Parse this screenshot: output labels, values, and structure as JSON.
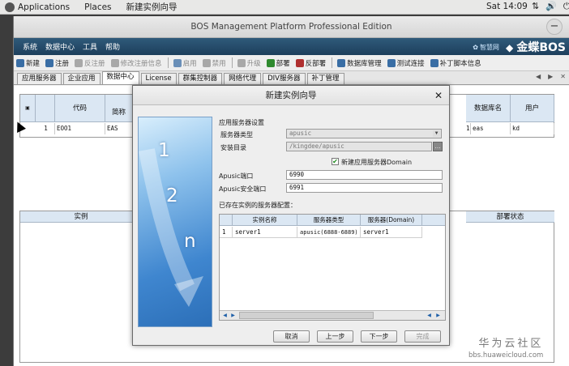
{
  "gnome": {
    "applications": "Applications",
    "places": "Places",
    "active_window": "新建实例向导",
    "clock": "Sat 14:09"
  },
  "window": {
    "title": "BOS Management Platform Professional Edition",
    "minimize": "−"
  },
  "menu": [
    "系统",
    "数据中心",
    "工具",
    "帮助"
  ],
  "brand": {
    "partner": "智慧网",
    "kingdee": "金蝶BOS"
  },
  "toolbar": [
    {
      "label": "新建",
      "color": "#3a6ea5",
      "disabled": false
    },
    {
      "label": "注册",
      "color": "#3a6ea5",
      "disabled": false
    },
    {
      "label": "反注册",
      "color": "#8a8a8a",
      "disabled": true
    },
    {
      "label": "修改注册信息",
      "color": "#8a8a8a",
      "disabled": true
    },
    {
      "label": "启用",
      "color": "#3a6ea5",
      "disabled": true
    },
    {
      "label": "禁用",
      "color": "#8a8a8a",
      "disabled": true
    },
    {
      "label": "升级",
      "color": "#8a8a8a",
      "disabled": true
    },
    {
      "label": "部署",
      "color": "#2f8a2f",
      "disabled": false
    },
    {
      "label": "反部署",
      "color": "#b03030",
      "disabled": false
    },
    {
      "label": "数据库管理",
      "color": "#3a6ea5",
      "disabled": false
    },
    {
      "label": "测试连接",
      "color": "#3a6ea5",
      "disabled": false
    },
    {
      "label": "补丁脚本信息",
      "color": "#3a6ea5",
      "disabled": false
    }
  ],
  "tabs": [
    "应用服务器",
    "企业应用",
    "数据中心",
    "License",
    "群集控制器",
    "网络代理",
    "DIV服务器",
    "补丁管理"
  ],
  "active_tab": "数据中心",
  "top_grid": {
    "headers": [
      "代码",
      "简称",
      "数据库名",
      "用户"
    ],
    "row": {
      "num": "1",
      "code": "EOO1",
      "short": "EAS",
      "partial": "1",
      "dbname": "eas",
      "user": "kd"
    }
  },
  "bottom_grid": {
    "headers": [
      "实例",
      "部署状态"
    ]
  },
  "dialog": {
    "title": "新建实例向导",
    "steps": [
      "1",
      "2",
      "n"
    ],
    "section_title": "应用服务器设置",
    "server_type_label": "服务器类型",
    "server_type_value": "apusic",
    "install_dir_label": "安装目录",
    "install_dir_value": "/kingdee/apusic",
    "new_domain_label": "新建应用服务器Domain",
    "new_domain_checked": true,
    "port_label": "Apusic端口",
    "port_value": "6990",
    "secure_port_label": "Apusic安全端口",
    "secure_port_value": "6991",
    "existing_label": "已存在实例的服务器配置：",
    "table_headers": [
      "实例名称",
      "服务器类型",
      "服务器(Domain)"
    ],
    "table_rows": [
      {
        "num": "1",
        "name": "server1",
        "type": "apusic(6888-6889)",
        "domain": "server1"
      }
    ],
    "buttons": {
      "cancel": "取消",
      "prev": "上一步",
      "next": "下一步",
      "finish": "完成"
    }
  },
  "watermark": {
    "line1": "华为云社区",
    "line2": "bbs.huaweicloud.com"
  }
}
